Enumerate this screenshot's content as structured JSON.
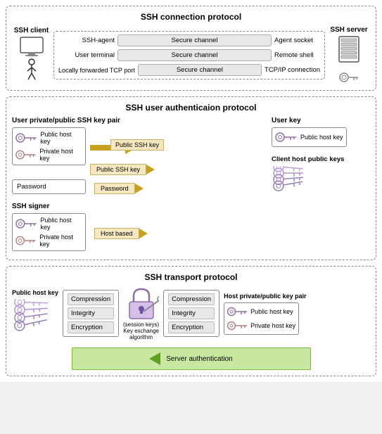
{
  "section1": {
    "title": "SSH connection protocol",
    "client_label": "SSH client",
    "rows": [
      {
        "left": "SSH-agent",
        "middle": "Secure channel",
        "right": "Agent socket"
      },
      {
        "left": "User terminal",
        "middle": "Secure channel",
        "right": "Remote shell"
      },
      {
        "left": "Locally forwarded TCP port",
        "middle": "Secure channel",
        "right": "TCP/IP connection"
      }
    ],
    "server_label": "SSH server"
  },
  "section2": {
    "title": "SSH user authenticaion protocol",
    "left_subtitle": "User private/public SSH key pair",
    "right_subtitle": "User key",
    "keypair1": {
      "top_label": "Public host key",
      "bottom_label": "Private host key"
    },
    "arrow1_label": "Public SSH key",
    "password_label": "Password",
    "arrow2_label": "Password",
    "client_host_keys_label": "Client host public keys",
    "signer_label": "SSH signer",
    "keypair2": {
      "top_label": "Public host key",
      "bottom_label": "Private host key"
    },
    "arrow3_label": "Host based"
  },
  "section3": {
    "title": "SSH transport protocol",
    "left_keys_label": "Public host key",
    "left_comp": [
      "Compression",
      "Integrity",
      "Encryption"
    ],
    "kex_label": "(session keys)\nKey exchange\nalgorithm",
    "right_comp": [
      "Compression",
      "Integrity",
      "Encryption"
    ],
    "right_pair_title": "Host private/public key pair",
    "right_pair_pub": "Public host key",
    "right_pair_priv": "Private host key",
    "server_auth_label": "Server authentication"
  }
}
